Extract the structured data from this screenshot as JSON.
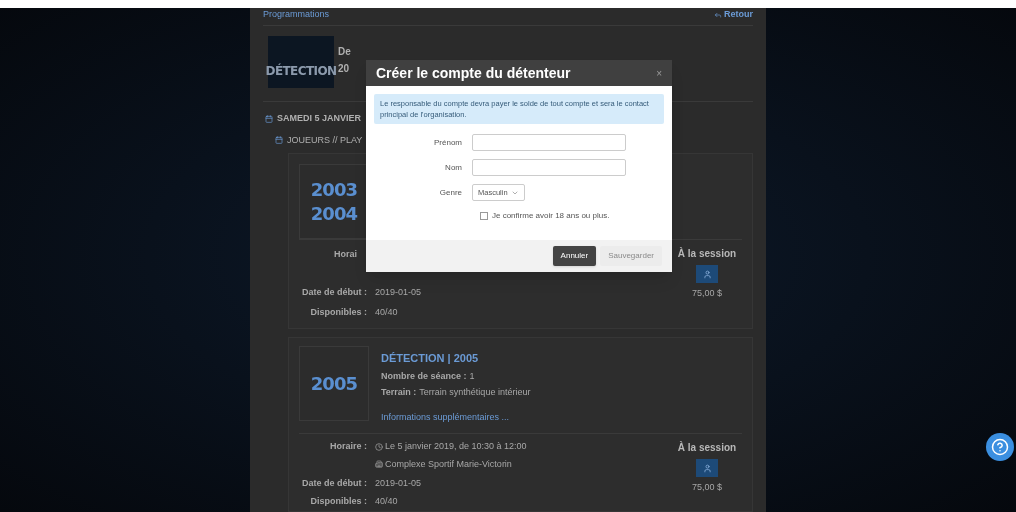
{
  "header": {
    "breadcrumb": "Programmations",
    "back_link": "Retour"
  },
  "event": {
    "logo_text": "DÉTECTION",
    "title": "De",
    "date": "20"
  },
  "day": "SAMEDI 5 JANVIER",
  "category": "JOUEURS // PLAY",
  "sessions": [
    {
      "years": [
        "2003",
        "2004"
      ],
      "schedule_label": "Horai",
      "price_label": "À la session",
      "price": "75,00 $",
      "start_label": "Date de début :",
      "start": "2019-01-05",
      "available_label": "Disponibles :",
      "available": "40/40"
    },
    {
      "years": [
        "2005"
      ],
      "title": "DÉTECTION | 2005",
      "details": [
        {
          "label": "Nombre de séance :",
          "value": "1"
        },
        {
          "label": "Terrain :",
          "value": "Terrain synthétique intérieur"
        }
      ],
      "link": "Informations supplémentaires ...",
      "schedule_label": "Horaire :",
      "schedule_time": "Le 5 janvier 2019, de 10:30 à 12:00",
      "schedule_place": "Complexe Sportif Marie-Victorin",
      "price_label": "À la session",
      "price": "75,00 $",
      "start_label": "Date de début :",
      "start": "2019-01-05",
      "available_label": "Disponibles :",
      "available": "40/40"
    }
  ],
  "modal": {
    "title": "Créer le compte du détenteur",
    "close": "×",
    "notice": "Le responsable du compte devra payer le solde de tout compte et sera le contact principal de l'organisation.",
    "fields": [
      {
        "label": "Prénom",
        "kind": "text"
      },
      {
        "label": "Nom",
        "kind": "text"
      },
      {
        "label": "Genre",
        "kind": "select",
        "value": "Masculin"
      }
    ],
    "confirm": {
      "label": "Je confirme avoir 18 ans ou plus.",
      "checked": false
    },
    "buttons": [
      {
        "label": "Annuler",
        "kind": "secondary",
        "disabled": false
      },
      {
        "label": "Sauvegarder",
        "kind": "primary",
        "disabled": true
      }
    ]
  }
}
